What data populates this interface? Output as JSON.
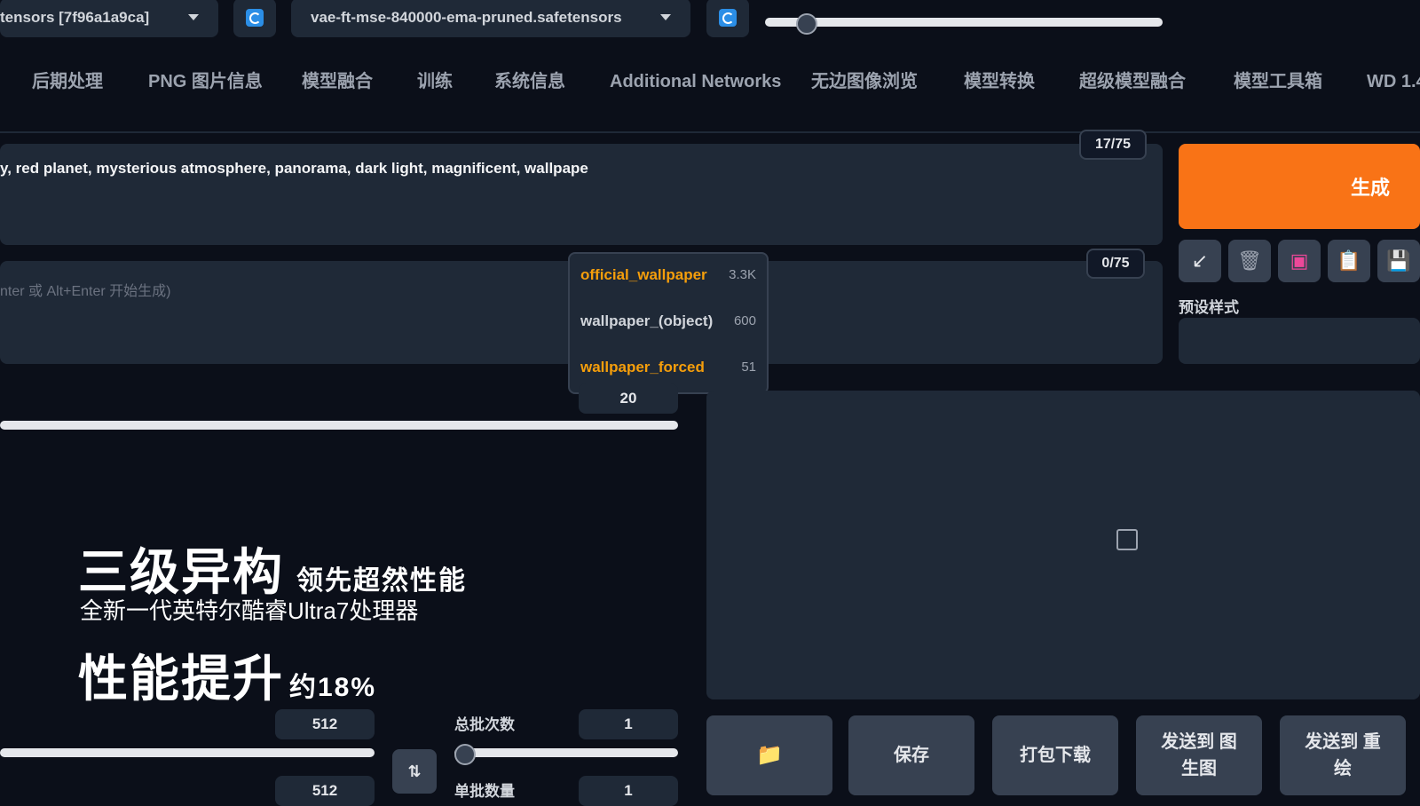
{
  "top": {
    "checkpoint_value": "tensors [7f96a1a9ca]",
    "vae_value": "vae-ft-mse-840000-ema-pruned.safetensors",
    "clip_skip_progress": 0.1
  },
  "tabs": [
    {
      "label": "后期处理"
    },
    {
      "label": "PNG 图片信息"
    },
    {
      "label": "模型融合"
    },
    {
      "label": "训练"
    },
    {
      "label": "系统信息"
    },
    {
      "label": "Additional Networks"
    },
    {
      "label": "无边图像浏览"
    },
    {
      "label": "模型转换"
    },
    {
      "label": "超级模型融合"
    },
    {
      "label": "模型工具箱"
    },
    {
      "label": "WD 1.4"
    }
  ],
  "prompt": {
    "text": "y, red planet, mysterious atmosphere, panorama, dark light, magnificent, wallpape",
    "token_count": "17/75"
  },
  "negative_prompt": {
    "placeholder": "nter 或 Alt+Enter 开始生成)",
    "token_count": "0/75"
  },
  "autocomplete": [
    {
      "name": "official_wallpaper",
      "count": "3.3K",
      "color": "#f59e0b"
    },
    {
      "name": "wallpaper_(object)",
      "count": "600",
      "color": "#d1d5db"
    },
    {
      "name": "wallpaper_forced",
      "count": "51",
      "color": "#f59e0b"
    }
  ],
  "actions": {
    "generate_label": "生成",
    "styles_label": "预设样式"
  },
  "sampling": {
    "steps_value": "20"
  },
  "size": {
    "width_value": "512",
    "height_value": "512"
  },
  "batch": {
    "count_label": "总批次数",
    "count_value": "1",
    "size_label": "单批数量",
    "size_value": "1"
  },
  "output_buttons": {
    "save": "保存",
    "zip": "打包下载",
    "send_img2img": "发送到 图生图",
    "send_inpaint": "发送到 重绘"
  },
  "ad_overlay": {
    "headline": "三级异构",
    "headline_sub": "领先超然性能",
    "line2": "全新一代英特尔酷睿Ultra7处理器",
    "line3": "性能提升",
    "line3_sub": "约18%"
  }
}
